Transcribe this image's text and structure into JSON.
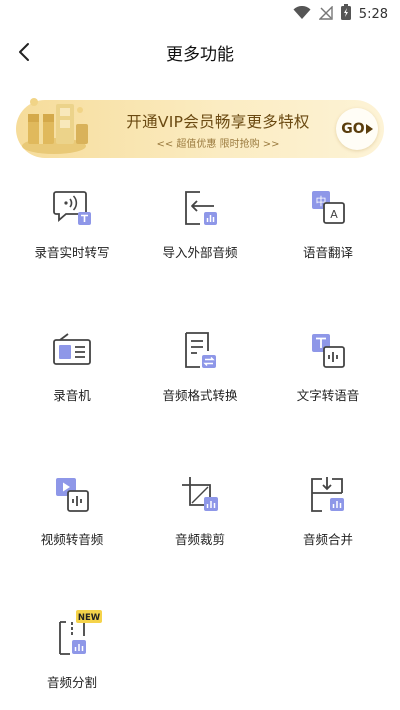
{
  "status_bar": {
    "time": "5:28"
  },
  "header": {
    "title": "更多功能"
  },
  "vip_banner": {
    "title": "开通VIP会员畅享更多特权",
    "subtitle": "<< 超值优惠   限时抢购 >>",
    "go_label": "GO"
  },
  "colors": {
    "accent": "#8e97e8",
    "icon_stroke": "#444444",
    "banner_gold": "#f6dc9a"
  },
  "features": [
    {
      "label": "录音实时转写",
      "icon": "live-transcribe-icon"
    },
    {
      "label": "导入外部音频",
      "icon": "import-audio-icon"
    },
    {
      "label": "语音翻译",
      "icon": "voice-translate-icon"
    },
    {
      "label": "录音机",
      "icon": "recorder-icon"
    },
    {
      "label": "音频格式转换",
      "icon": "format-convert-icon"
    },
    {
      "label": "文字转语音",
      "icon": "text-to-speech-icon"
    },
    {
      "label": "视频转音频",
      "icon": "video-to-audio-icon"
    },
    {
      "label": "音频裁剪",
      "icon": "audio-crop-icon"
    },
    {
      "label": "音频合并",
      "icon": "audio-merge-icon"
    },
    {
      "label": "音频分割",
      "icon": "audio-split-icon",
      "badge": "NEW"
    }
  ]
}
